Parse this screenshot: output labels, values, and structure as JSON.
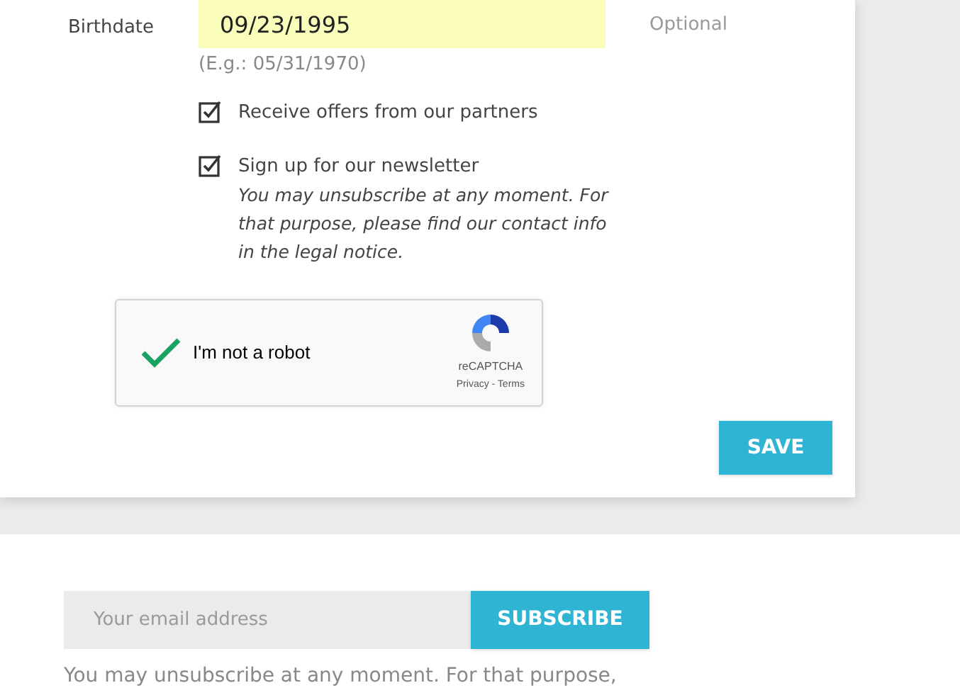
{
  "form": {
    "birthdate": {
      "label": "Birthdate",
      "value": "09/23/1995",
      "note": "Optional",
      "hint": "(E.g.: 05/31/1970)"
    },
    "options": [
      {
        "label": "Receive offers from our partners",
        "checked": true
      },
      {
        "label": "Sign up for our newsletter",
        "checked": true,
        "description": "You may unsubscribe at any moment. For that purpose, please find our contact info in the legal notice."
      }
    ],
    "captcha": {
      "label": "I'm not a robot",
      "checked": true,
      "brand": "reCAPTCHA",
      "links": "Privacy - Terms"
    },
    "save_button": "SAVE"
  },
  "newsletter": {
    "placeholder": "Your email address",
    "button": "SUBSCRIBE",
    "text": "You may unsubscribe at any moment. For that purpose,"
  }
}
